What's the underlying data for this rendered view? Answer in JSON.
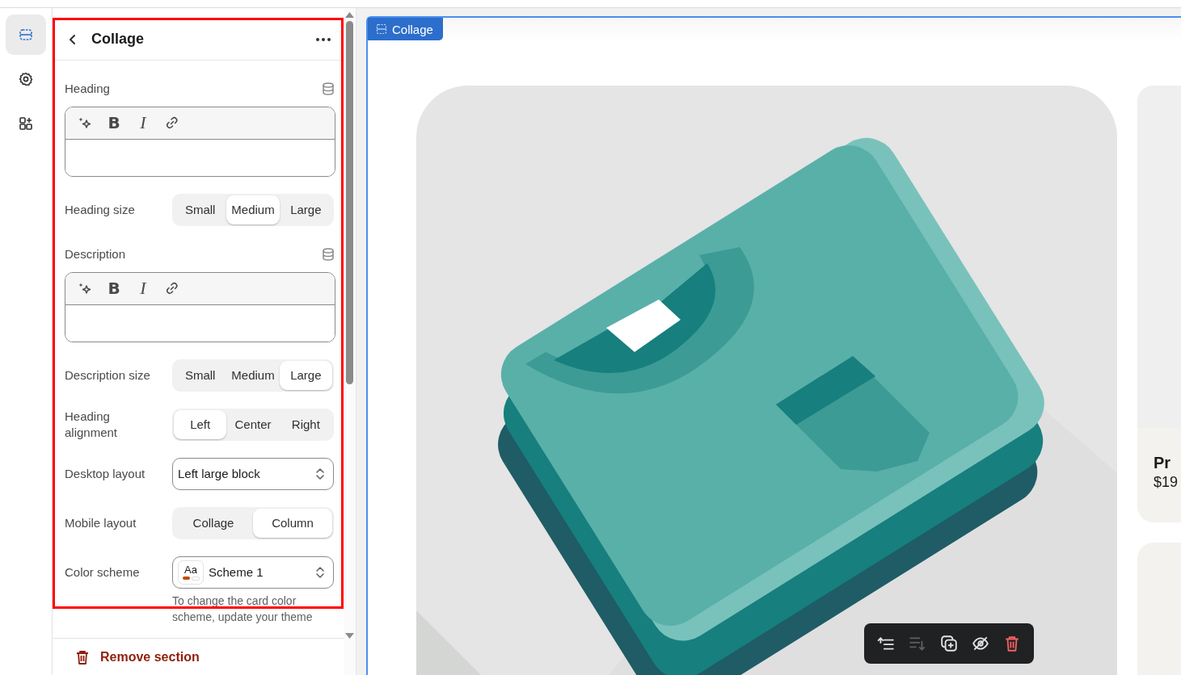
{
  "rail": [
    {
      "kind": "sections",
      "selected": true
    },
    {
      "kind": "settings",
      "selected": false
    },
    {
      "kind": "apps",
      "selected": false
    }
  ],
  "panel": {
    "title": "Collage",
    "fields": [
      {
        "kind": "richtext",
        "label": "Heading",
        "tools": [
          {
            "kind": "ai"
          },
          {
            "kind": "bold",
            "glyph": "B"
          },
          {
            "kind": "italic",
            "glyph": "I"
          },
          {
            "kind": "link"
          }
        ]
      },
      {
        "kind": "segmented",
        "label": "Heading size",
        "options": [
          {
            "label": "Small",
            "selected": false
          },
          {
            "label": "Medium",
            "selected": true
          },
          {
            "label": "Large",
            "selected": false
          }
        ]
      },
      {
        "kind": "richtext",
        "label": "Description",
        "tools": [
          {
            "kind": "ai"
          },
          {
            "kind": "bold",
            "glyph": "B"
          },
          {
            "kind": "italic",
            "glyph": "I"
          },
          {
            "kind": "link"
          }
        ]
      },
      {
        "kind": "segmented",
        "label": "Description size",
        "options": [
          {
            "label": "Small",
            "selected": false
          },
          {
            "label": "Medium",
            "selected": false
          },
          {
            "label": "Large",
            "selected": true
          }
        ]
      },
      {
        "kind": "segmented",
        "label": "Heading alignment",
        "options": [
          {
            "label": "Left",
            "selected": true
          },
          {
            "label": "Center",
            "selected": false
          },
          {
            "label": "Right",
            "selected": false
          }
        ]
      },
      {
        "kind": "select",
        "label": "Desktop layout",
        "value": "Left large block"
      },
      {
        "kind": "segmented",
        "label": "Mobile layout",
        "options": [
          {
            "label": "Collage",
            "selected": false
          },
          {
            "label": "Column",
            "selected": true
          }
        ]
      },
      {
        "kind": "scheme",
        "label": "Color scheme",
        "swatch": "Aa",
        "value": "Scheme 1",
        "hint": "To change the card color scheme, update your theme"
      }
    ],
    "remove_button": "Remove section"
  },
  "preview": {
    "section_tab": "Collage",
    "product_card": {
      "title": "Pr",
      "price": "$19"
    },
    "actions": [
      {
        "kind": "move-up",
        "disabled": false
      },
      {
        "kind": "move-down",
        "disabled": true
      },
      {
        "kind": "duplicate",
        "disabled": false
      },
      {
        "kind": "hide",
        "disabled": false
      },
      {
        "kind": "delete",
        "disabled": false
      }
    ]
  }
}
